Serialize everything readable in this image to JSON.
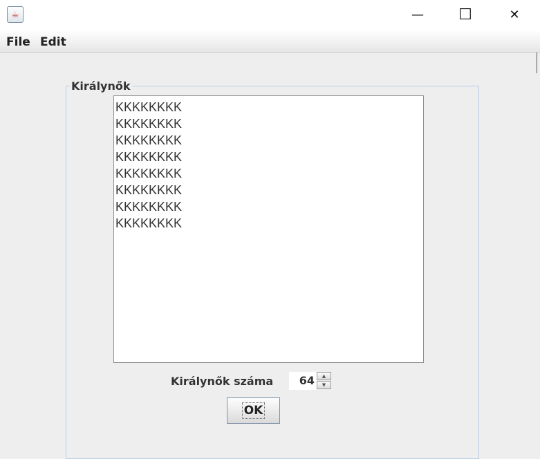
{
  "window": {
    "minimize_glyph": "—",
    "maximize_glyph": "☐",
    "close_glyph": "✕"
  },
  "menu": {
    "file": "File",
    "edit": "Edit"
  },
  "group": {
    "title": "Királynők"
  },
  "board": {
    "rows": [
      "KKKKKKKK",
      "KKKKKKKK",
      "KKKKKKKK",
      "KKKKKKKK",
      "KKKKKKKK",
      "KKKKKKKK",
      "KKKKKKKK",
      "KKKKKKKK"
    ]
  },
  "count": {
    "label": "Királynők száma",
    "value": "64"
  },
  "ok": {
    "label": "OK"
  },
  "colors": {
    "background": "#eeeeee",
    "group_border": "#b8cfe5",
    "button_border": "#7a8ea8"
  }
}
